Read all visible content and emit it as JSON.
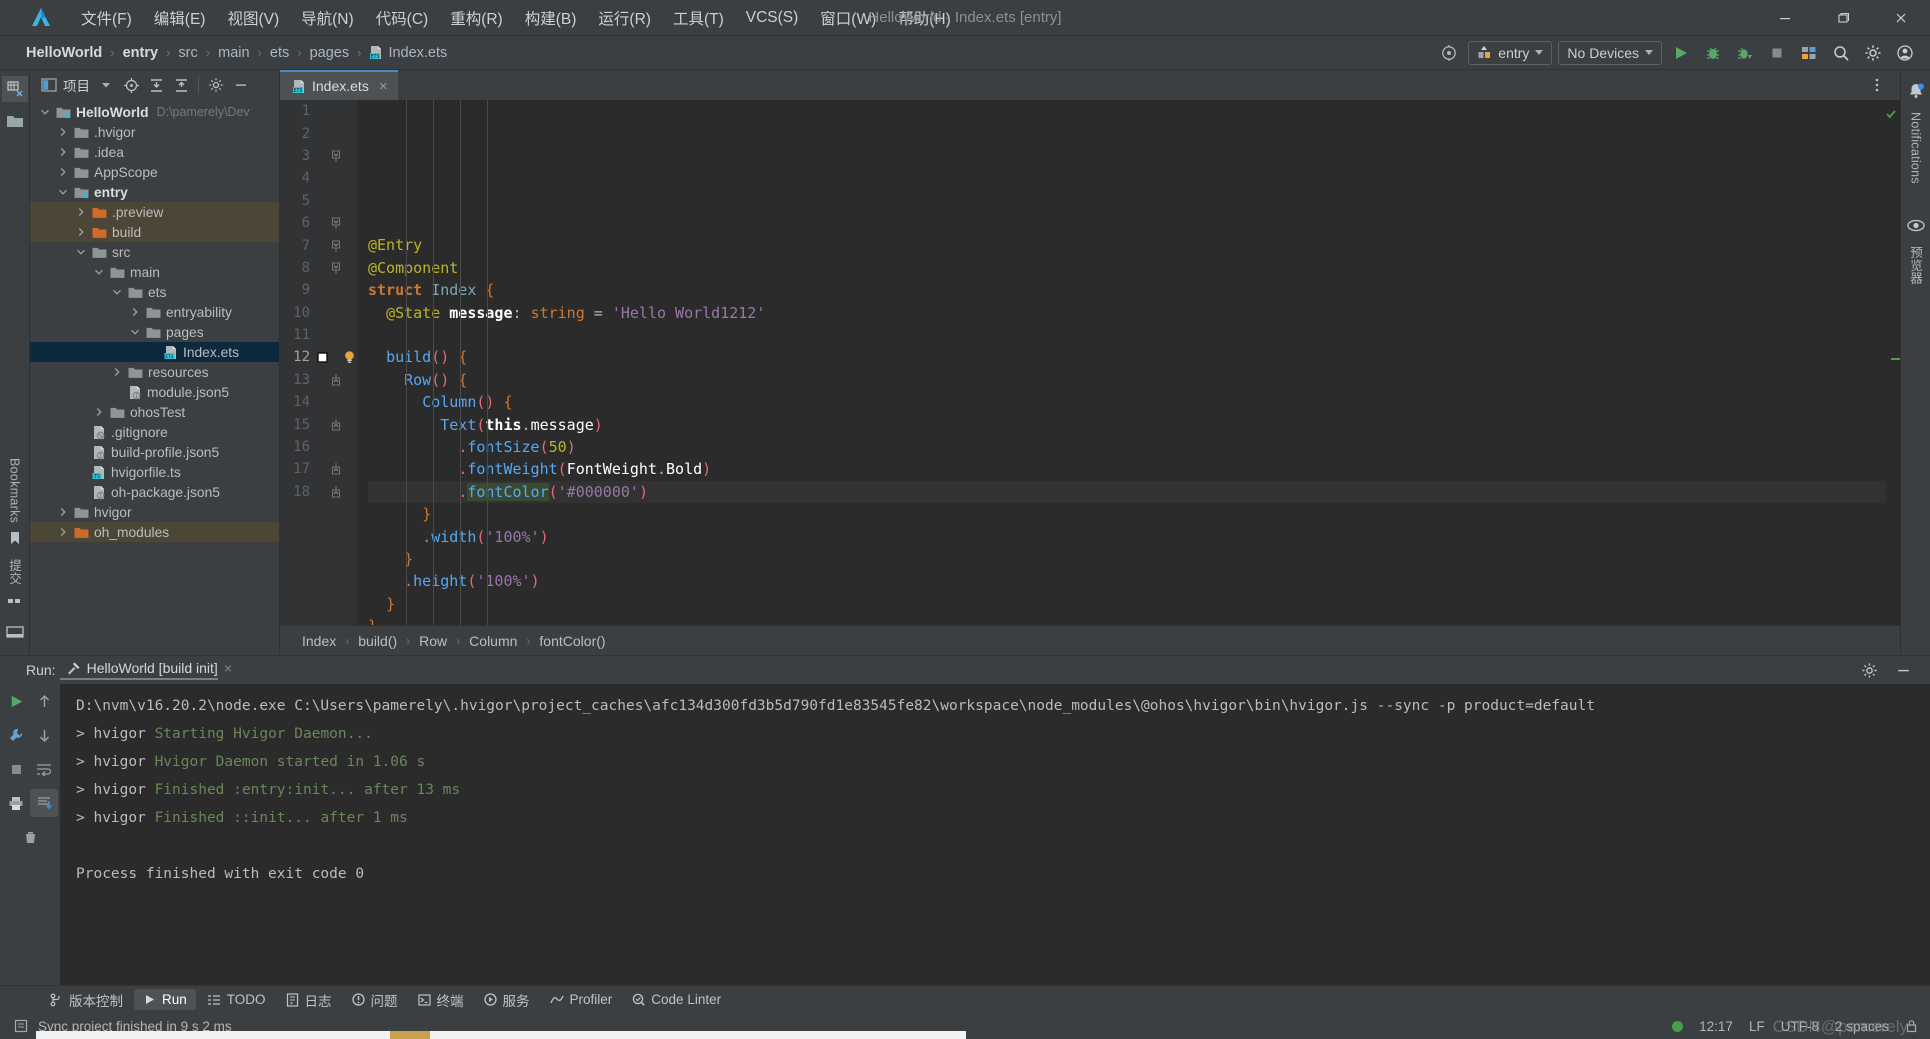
{
  "window": {
    "title": "HelloWorld - Index.ets [entry]",
    "logo_icon": "deveco-logo-icon",
    "minimize_icon": "minimize-icon",
    "restore_icon": "restore-icon",
    "close_icon": "close-icon"
  },
  "menubar": {
    "items": [
      {
        "label": "文件(F)",
        "name": "menu-file"
      },
      {
        "label": "编辑(E)",
        "name": "menu-edit"
      },
      {
        "label": "视图(V)",
        "name": "menu-view"
      },
      {
        "label": "导航(N)",
        "name": "menu-navigate"
      },
      {
        "label": "代码(C)",
        "name": "menu-code"
      },
      {
        "label": "重构(R)",
        "name": "menu-refactor"
      },
      {
        "label": "构建(B)",
        "name": "menu-build"
      },
      {
        "label": "运行(R)",
        "name": "menu-run"
      },
      {
        "label": "工具(T)",
        "name": "menu-tools"
      },
      {
        "label": "VCS(S)",
        "name": "menu-vcs"
      },
      {
        "label": "窗口(W)",
        "name": "menu-window"
      },
      {
        "label": "帮助(H)",
        "name": "menu-help"
      }
    ]
  },
  "navbar": {
    "breadcrumb": [
      "HelloWorld",
      "entry",
      "src",
      "main",
      "ets",
      "pages",
      "Index.ets"
    ],
    "separator": "›",
    "file_icon": "ets-file-icon",
    "target_icon": "target-icon",
    "run_config": "entry",
    "run_config_icon": "module-icon",
    "device_selector": "No Devices",
    "actions": [
      {
        "name": "run-button",
        "icon": "run-triangle-icon",
        "color": "#59a869"
      },
      {
        "name": "debug-button",
        "icon": "debug-bug-icon",
        "color": "#59a869"
      },
      {
        "name": "run-coverage-button",
        "icon": "run-coverage-icon",
        "color": "#59a869"
      },
      {
        "name": "stop-button",
        "icon": "stop-square-icon",
        "color": "#808080"
      },
      {
        "name": "device-manager-button",
        "icon": "device-manager-icon",
        "color": "#9aa7b0"
      },
      {
        "name": "search-button",
        "icon": "search-icon",
        "color": "#cdcdcd"
      },
      {
        "name": "settings-button",
        "icon": "gear-icon",
        "color": "#cdcdcd"
      },
      {
        "name": "account-button",
        "icon": "account-icon",
        "color": "#cdcdcd"
      }
    ]
  },
  "left_rail": {
    "items": [
      {
        "name": "rail-structure-icon",
        "icon": "structure-icon",
        "label": "结构",
        "active": false
      },
      {
        "name": "rail-project-icon",
        "icon": "folder-icon",
        "label": "",
        "active": true
      }
    ],
    "bookmarks_label": "Bookmarks",
    "bookmarks_icon": "bookmark-icon",
    "commit_label": "提交",
    "commit_icon": "commit-icon",
    "terminal_icon": "terminal-window-icon"
  },
  "right_rail": {
    "notifications_label": "Notifications",
    "notifications_icon": "bell-icon",
    "preview_label": "预览器",
    "preview_icon": "eye-icon"
  },
  "project_panel": {
    "title": "项目",
    "title_icon": "project-window-icon",
    "toolbar": [
      {
        "name": "project-dropdown",
        "icon": "chevron-down-icon"
      },
      {
        "name": "select-opened-file-button",
        "icon": "crosshair-icon"
      },
      {
        "name": "expand-all-button",
        "icon": "expand-all-icon"
      },
      {
        "name": "collapse-all-button",
        "icon": "collapse-all-icon"
      },
      {
        "name": "settings-button",
        "icon": "gear-icon"
      },
      {
        "name": "hide-button",
        "icon": "minus-icon"
      }
    ],
    "tree": [
      {
        "label": "HelloWorld",
        "path": "D:\\pamerely\\Dev",
        "depth": 0,
        "arrow": "down",
        "icon": "project-folder-icon",
        "bold": true,
        "state": "normal"
      },
      {
        "label": ".hvigor",
        "depth": 1,
        "arrow": "right",
        "icon": "folder-icon",
        "state": "normal"
      },
      {
        "label": ".idea",
        "depth": 1,
        "arrow": "right",
        "icon": "folder-icon",
        "state": "normal"
      },
      {
        "label": "AppScope",
        "depth": 1,
        "arrow": "right",
        "icon": "folder-icon",
        "state": "normal"
      },
      {
        "label": "entry",
        "depth": 1,
        "arrow": "down",
        "icon": "module-folder-icon",
        "bold": true,
        "state": "normal"
      },
      {
        "label": ".preview",
        "depth": 2,
        "arrow": "right",
        "icon": "excluded-folder-icon",
        "state": "excluded"
      },
      {
        "label": "build",
        "depth": 2,
        "arrow": "right",
        "icon": "excluded-folder-icon",
        "state": "excluded"
      },
      {
        "label": "src",
        "depth": 2,
        "arrow": "down",
        "icon": "folder-icon",
        "state": "normal"
      },
      {
        "label": "main",
        "depth": 3,
        "arrow": "down",
        "icon": "folder-icon",
        "state": "normal"
      },
      {
        "label": "ets",
        "depth": 4,
        "arrow": "down",
        "icon": "folder-icon",
        "state": "normal"
      },
      {
        "label": "entryability",
        "depth": 5,
        "arrow": "right",
        "icon": "folder-icon",
        "state": "normal"
      },
      {
        "label": "pages",
        "depth": 5,
        "arrow": "down",
        "icon": "folder-icon",
        "state": "normal"
      },
      {
        "label": "Index.ets",
        "depth": 6,
        "arrow": "none",
        "icon": "ets-file-icon",
        "state": "selected"
      },
      {
        "label": "resources",
        "depth": 4,
        "arrow": "right",
        "icon": "folder-icon",
        "state": "normal"
      },
      {
        "label": "module.json5",
        "depth": 4,
        "arrow": "none",
        "icon": "json5-file-icon",
        "state": "normal"
      },
      {
        "label": "ohosTest",
        "depth": 3,
        "arrow": "right",
        "icon": "folder-icon",
        "state": "normal"
      },
      {
        "label": ".gitignore",
        "depth": 2,
        "arrow": "none",
        "icon": "gitignore-file-icon",
        "state": "normal"
      },
      {
        "label": "build-profile.json5",
        "depth": 2,
        "arrow": "none",
        "icon": "json5-file-icon",
        "state": "normal"
      },
      {
        "label": "hvigorfile.ts",
        "depth": 2,
        "arrow": "none",
        "icon": "ts-file-icon",
        "state": "normal"
      },
      {
        "label": "oh-package.json5",
        "depth": 2,
        "arrow": "none",
        "icon": "json5-file-icon",
        "state": "normal"
      },
      {
        "label": "hvigor",
        "depth": 1,
        "arrow": "right",
        "icon": "folder-icon",
        "state": "normal"
      },
      {
        "label": "oh_modules",
        "depth": 1,
        "arrow": "right",
        "icon": "excluded-folder-icon",
        "state": "excluded"
      }
    ]
  },
  "editor": {
    "tab": {
      "label": "Index.ets",
      "icon": "ets-file-icon",
      "close_icon": "close-icon"
    },
    "more_icon": "more-vertical-icon",
    "inspection_ok_icon": "checkmark-icon",
    "lines": [
      {
        "n": 1,
        "fold": "none",
        "indent": 0
      },
      {
        "n": 2,
        "fold": "none",
        "indent": 0
      },
      {
        "n": 3,
        "fold": "start",
        "indent": 0
      },
      {
        "n": 4,
        "fold": "none",
        "indent": 1
      },
      {
        "n": 5,
        "fold": "none",
        "indent": 1
      },
      {
        "n": 6,
        "fold": "start",
        "indent": 1
      },
      {
        "n": 7,
        "fold": "start",
        "indent": 2
      },
      {
        "n": 8,
        "fold": "start",
        "indent": 3
      },
      {
        "n": 9,
        "fold": "none",
        "indent": 4
      },
      {
        "n": 10,
        "fold": "none",
        "indent": 5
      },
      {
        "n": 11,
        "fold": "none",
        "indent": 5
      },
      {
        "n": 12,
        "fold": "none",
        "indent": 5,
        "current": true,
        "bulb": "intention-bulb-icon",
        "breakpoint_gutter": "method-marker-icon"
      },
      {
        "n": 13,
        "fold": "end",
        "indent": 3
      },
      {
        "n": 14,
        "fold": "none",
        "indent": 3
      },
      {
        "n": 15,
        "fold": "end",
        "indent": 2
      },
      {
        "n": 16,
        "fold": "none",
        "indent": 2
      },
      {
        "n": 17,
        "fold": "end",
        "indent": 1
      },
      {
        "n": 18,
        "fold": "end",
        "indent": 0
      }
    ],
    "source_text": [
      "@Entry",
      "@Component",
      "struct Index {",
      "  @State message: string = 'Hello World1212'",
      "",
      "  build() {",
      "    Row() {",
      "      Column() {",
      "        Text(this.message)",
      "          .fontSize(50)",
      "          .fontWeight(FontWeight.Bold)",
      "          .fontColor('#000000')",
      "      }",
      "      .width('100%')",
      "    }",
      "    .height('100%')",
      "  }",
      "}"
    ],
    "breadcrumbs": [
      "Index",
      "build()",
      "Row",
      "Column",
      "fontColor()"
    ],
    "breadcrumb_separator": "›"
  },
  "run_panel": {
    "label": "Run:",
    "tab_label": "HelloWorld [build init]",
    "tab_icon": "hammer-icon",
    "tab_close_icon": "close-icon",
    "settings_icon": "gear-icon",
    "hide_icon": "minus-icon",
    "side_actions": [
      {
        "name": "rerun-button",
        "icon": "run-triangle-icon",
        "color": "#59a869"
      },
      {
        "name": "up-button",
        "icon": "arrow-up-icon",
        "color": "#9aa0a6"
      },
      {
        "name": "wrench-button",
        "icon": "wrench-icon",
        "color": "#9aa0a6"
      },
      {
        "name": "down-button",
        "icon": "arrow-down-icon",
        "color": "#9aa0a6"
      },
      {
        "name": "stop-button",
        "icon": "stop-square-icon",
        "color": "#8a8a8a"
      },
      {
        "name": "soft-wrap-button",
        "icon": "soft-wrap-icon",
        "color": "#9aa0a6"
      },
      {
        "name": "scroll-to-end-button",
        "icon": "scroll-end-icon",
        "color": "#4a88c7"
      },
      {
        "name": "print-button",
        "icon": "printer-icon",
        "color": "#9aa0a6"
      },
      {
        "name": "clear-all-button",
        "icon": "trash-icon",
        "color": "#9aa0a6"
      }
    ],
    "console_lines": [
      {
        "segments": [
          {
            "text": "D:\\nvm\\v16.20.2\\node.exe C:\\Users\\pamerely\\.hvigor\\project_caches\\afc134d300fd3b5d790fd1e83545fe82\\workspace\\node_modules\\@ohos\\hvigor\\bin\\hvigor.js --sync -p product=default",
            "style": "plain"
          }
        ]
      },
      {
        "segments": [
          {
            "text": "> hvigor ",
            "style": "plain"
          },
          {
            "text": "Starting Hvigor Daemon...",
            "style": "green"
          }
        ]
      },
      {
        "segments": [
          {
            "text": "> hvigor ",
            "style": "plain"
          },
          {
            "text": "Hvigor Daemon started in 1.06 s",
            "style": "green"
          }
        ]
      },
      {
        "segments": [
          {
            "text": "> hvigor ",
            "style": "plain"
          },
          {
            "text": "Finished :entry:init... after 13 ms",
            "style": "green"
          }
        ]
      },
      {
        "segments": [
          {
            "text": "> hvigor ",
            "style": "plain"
          },
          {
            "text": "Finished ::init... after 1 ms",
            "style": "green"
          }
        ]
      },
      {
        "segments": [
          {
            "text": "",
            "style": "plain"
          }
        ]
      },
      {
        "segments": [
          {
            "text": "Process finished with exit code 0",
            "style": "plain"
          }
        ]
      }
    ]
  },
  "tool_windows": [
    {
      "label": "版本控制",
      "icon": "vcs-branch-icon",
      "name": "toolwindow-version-control",
      "active": false
    },
    {
      "label": "Run",
      "icon": "run-triangle-icon",
      "name": "toolwindow-run",
      "active": true
    },
    {
      "label": "TODO",
      "icon": "todo-list-icon",
      "name": "toolwindow-todo",
      "active": false
    },
    {
      "label": "日志",
      "icon": "log-icon",
      "name": "toolwindow-log",
      "active": false
    },
    {
      "label": "问题",
      "icon": "problems-icon",
      "name": "toolwindow-problems",
      "active": false
    },
    {
      "label": "终端",
      "icon": "terminal-icon",
      "name": "toolwindow-terminal",
      "active": false
    },
    {
      "label": "服务",
      "icon": "services-icon",
      "name": "toolwindow-services",
      "active": false
    },
    {
      "label": "Profiler",
      "icon": "profiler-icon",
      "name": "toolwindow-profiler",
      "active": false
    },
    {
      "label": "Code Linter",
      "icon": "code-linter-icon",
      "name": "toolwindow-code-linter",
      "active": false
    }
  ],
  "statusbar": {
    "message": "Sync project finished in 9 s 2 ms",
    "message_icon": "event-log-icon",
    "time": "12:17",
    "line_separator": "LF",
    "encoding": "UTF-8",
    "indent": "2 spaces",
    "lock_icon": "lock-icon",
    "status_dot_color": "#49a04b"
  },
  "watermark": "CSDN@pamerely"
}
